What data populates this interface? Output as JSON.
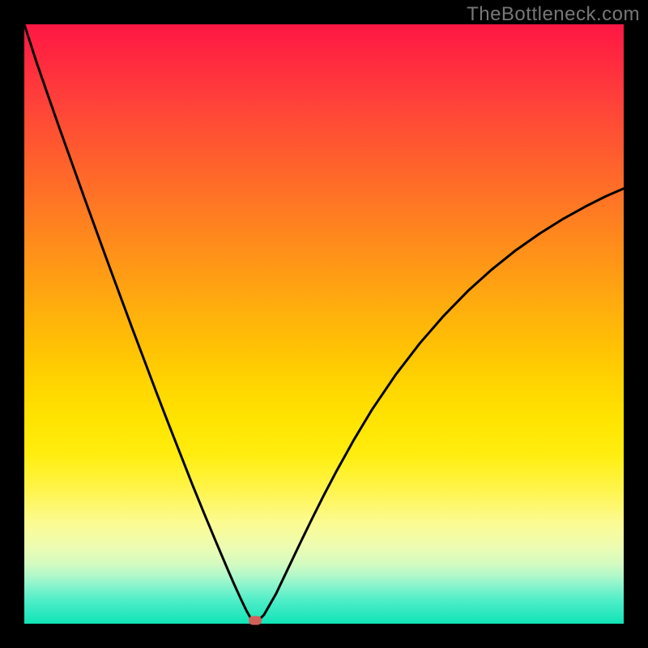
{
  "watermark": "TheBottleneck.com",
  "colors": {
    "frame": "#000000",
    "curve": "#000000",
    "marker": "#d2605a",
    "gradient_top": "#ff1744",
    "gradient_bottom": "#10e4b6"
  },
  "chart_data": {
    "type": "line",
    "title": "",
    "xlabel": "",
    "ylabel": "",
    "xlim": [
      0,
      100
    ],
    "ylim": [
      0,
      100
    ],
    "series": [
      {
        "name": "bottleneck-curve",
        "x": [
          0,
          2,
          4,
          6,
          8,
          10,
          12,
          14,
          16,
          18,
          20,
          22,
          24,
          26,
          28,
          30,
          32,
          34,
          35,
          36,
          37,
          38,
          39,
          40,
          42,
          44,
          46,
          48,
          50,
          52,
          55,
          58,
          62,
          66,
          70,
          74,
          78,
          82,
          86,
          90,
          94,
          97,
          100
        ],
        "y": [
          100,
          93.8,
          88.0,
          82.3,
          76.7,
          71.1,
          65.6,
          60.1,
          54.7,
          49.3,
          44.0,
          38.7,
          33.5,
          28.4,
          23.3,
          18.4,
          13.6,
          8.9,
          6.6,
          4.4,
          2.3,
          0.5,
          0.5,
          1.5,
          5.0,
          9.2,
          13.4,
          17.5,
          21.5,
          25.3,
          30.7,
          35.7,
          41.6,
          46.8,
          51.4,
          55.5,
          59.1,
          62.3,
          65.1,
          67.6,
          69.8,
          71.3,
          72.6
        ]
      }
    ],
    "marker": {
      "x": 38.5,
      "y": 0.5
    }
  }
}
